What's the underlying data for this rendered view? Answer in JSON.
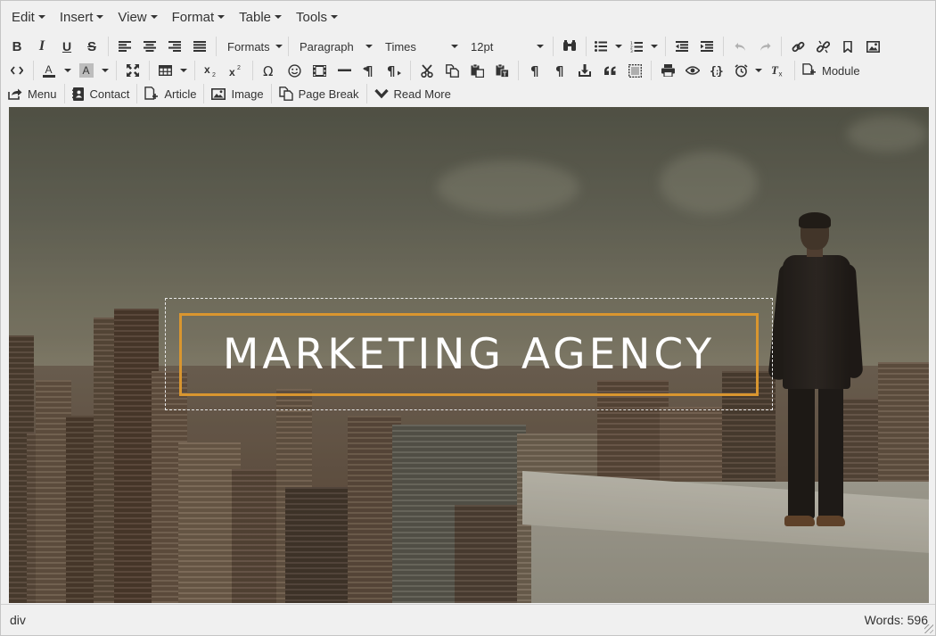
{
  "menubar": {
    "items": [
      {
        "label": "Edit"
      },
      {
        "label": "Insert"
      },
      {
        "label": "View"
      },
      {
        "label": "Format"
      },
      {
        "label": "Table"
      },
      {
        "label": "Tools"
      }
    ]
  },
  "toolbar1": {
    "bold": "B",
    "italic": "I",
    "underline": "U",
    "strikethrough": "S",
    "formats_label": "Formats",
    "block_format_value": "Paragraph",
    "font_family_value": "Times",
    "font_size_value": "12pt"
  },
  "toolbar2": {
    "module_label": "Module"
  },
  "toolbar3": {
    "menu_label": "Menu",
    "contact_label": "Contact",
    "article_label": "Article",
    "image_label": "Image",
    "page_break_label": "Page Break",
    "read_more_label": "Read More"
  },
  "content": {
    "heading": "MARKETING AGENCY",
    "accent_color": "#d9962f"
  },
  "statusbar": {
    "path": "div",
    "word_count": "Words: 596"
  },
  "icons": [
    "find-replace-icon",
    "bullet-list-icon",
    "numbered-list-icon",
    "outdent-icon",
    "indent-icon",
    "undo-icon",
    "redo-icon",
    "link-icon",
    "unlink-icon",
    "anchor-icon",
    "image-icon",
    "code-icon",
    "text-color-icon",
    "background-color-icon",
    "fullscreen-icon",
    "table-icon",
    "subscript-icon",
    "superscript-icon",
    "special-character-icon",
    "emoticons-icon",
    "media-icon",
    "horizontal-rule-icon",
    "ltr-icon",
    "rtl-icon",
    "cut-icon",
    "copy-icon",
    "paste-icon",
    "paste-text-icon",
    "show-blocks-icon",
    "nonbreaking-icon",
    "insert-template-icon",
    "blockquote-icon",
    "visual-aid-icon",
    "print-icon",
    "preview-icon",
    "code-sample-icon",
    "insert-datetime-icon",
    "remove-format-icon",
    "module-icon",
    "menu-icon",
    "contact-icon",
    "article-icon",
    "page-break-icon",
    "read-more-icon"
  ]
}
